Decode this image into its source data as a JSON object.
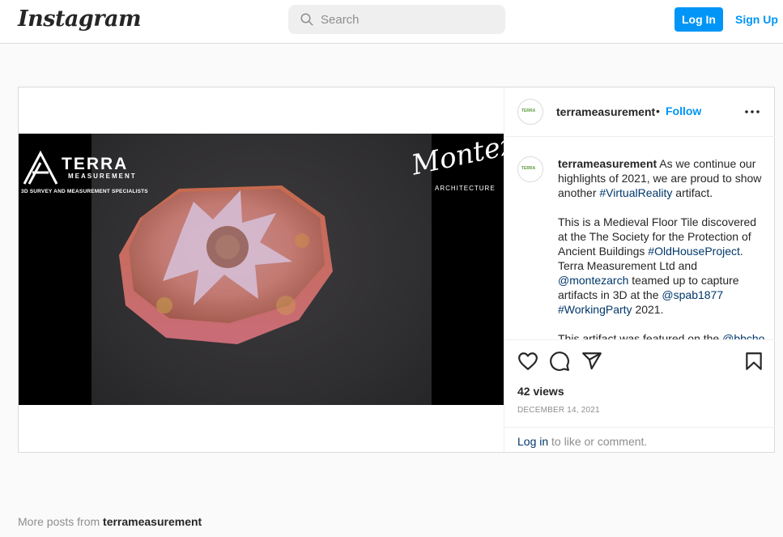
{
  "app": {
    "logo": "Instagram"
  },
  "search": {
    "placeholder": "Search"
  },
  "header": {
    "login": "Log In",
    "signup": "Sign Up"
  },
  "post": {
    "username": "terrameasurement",
    "separator": "•",
    "follow": "Follow",
    "avatar_text": "TERRA",
    "media": {
      "brand_name": "TERRA",
      "brand_sub": "MEASUREMENT",
      "brand_tagline": "3D SURVEY AND MEASUREMENT SPECIALISTS",
      "partner_name": "Montez",
      "partner_sub": "ARCHITECTURE"
    },
    "caption": {
      "p1_text": "As we continue our highlights of 2021, we are proud to show another ",
      "p1_tag": "#VirtualReality",
      "p1_end": " artifact.",
      "p2_a": "This is a Medieval Floor Tile discovered at the The Society for the Protection of Ancient Buildings ",
      "p2_tag1": "#OldHouseProject",
      "p2_b": ". Terra Measurement Ltd and ",
      "p2_mention1": "@montezarch",
      "p2_c": " teamed up to capture artifacts in 3D at the ",
      "p2_mention2": "@spab1877",
      "p2_d": " ",
      "p2_tag2": "#WorkingParty",
      "p2_e": " 2021.",
      "p3_a": "This artifact was featured on the ",
      "p3_mention": "@bbcho"
    },
    "views": "42 views",
    "date": "DECEMBER 14, 2021",
    "login_link": "Log in",
    "login_rest": " to like or comment."
  },
  "footer": {
    "more_prefix": "More posts from ",
    "more_user": "terrameasurement"
  },
  "colors": {
    "accent": "#0095f6",
    "link": "#00376b",
    "muted": "#8e8e8e"
  },
  "icons": [
    "search-icon",
    "more-options-icon",
    "heart-icon",
    "comment-icon",
    "share-icon",
    "bookmark-icon"
  ]
}
